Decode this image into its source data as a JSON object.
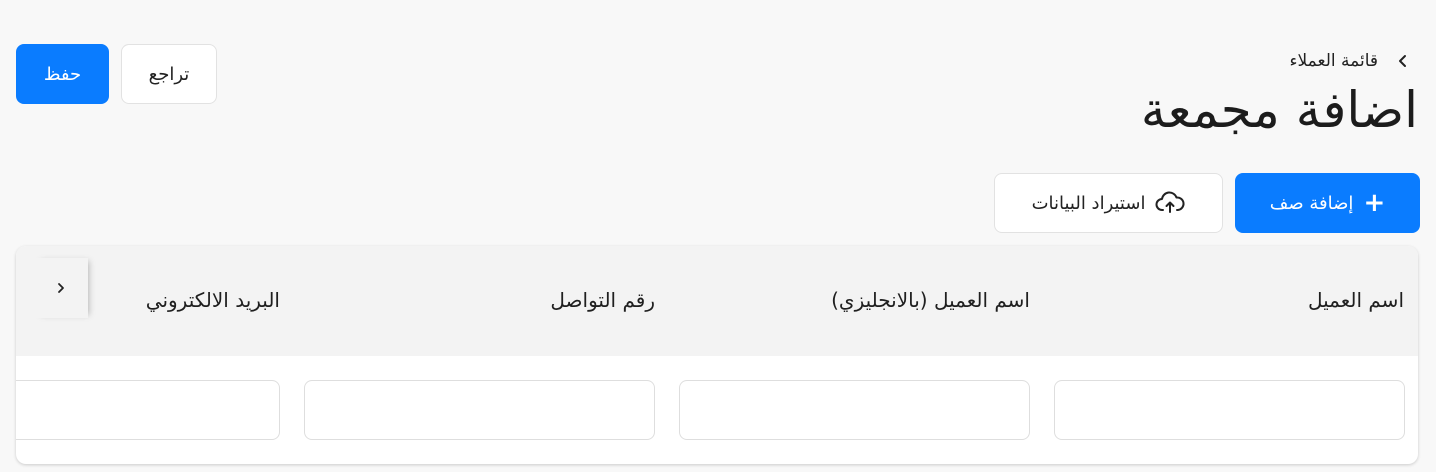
{
  "header": {
    "save_label": "حفظ",
    "back_label": "تراجع",
    "breadcrumb_label": "قائمة العملاء",
    "title": "اضافة مجمعة"
  },
  "actions": {
    "add_row_label": "إضافة صف",
    "import_label": "استيراد البيانات"
  },
  "table": {
    "columns": [
      {
        "label": "اسم العميل",
        "value": "",
        "placeholder": ""
      },
      {
        "label": "اسم العميل (بالانجليزي)",
        "value": "",
        "placeholder": ""
      },
      {
        "label": "رقم التواصل",
        "value": "",
        "placeholder": ""
      },
      {
        "label": "البريد الالكتروني",
        "value": "",
        "placeholder": ""
      }
    ]
  },
  "colors": {
    "primary": "#0a7cff",
    "background": "#f8f8f8",
    "header_row": "#f3f3f3"
  },
  "icons": [
    "chevron-left-icon",
    "plus-icon",
    "cloud-upload-icon",
    "chevron-right-icon"
  ]
}
